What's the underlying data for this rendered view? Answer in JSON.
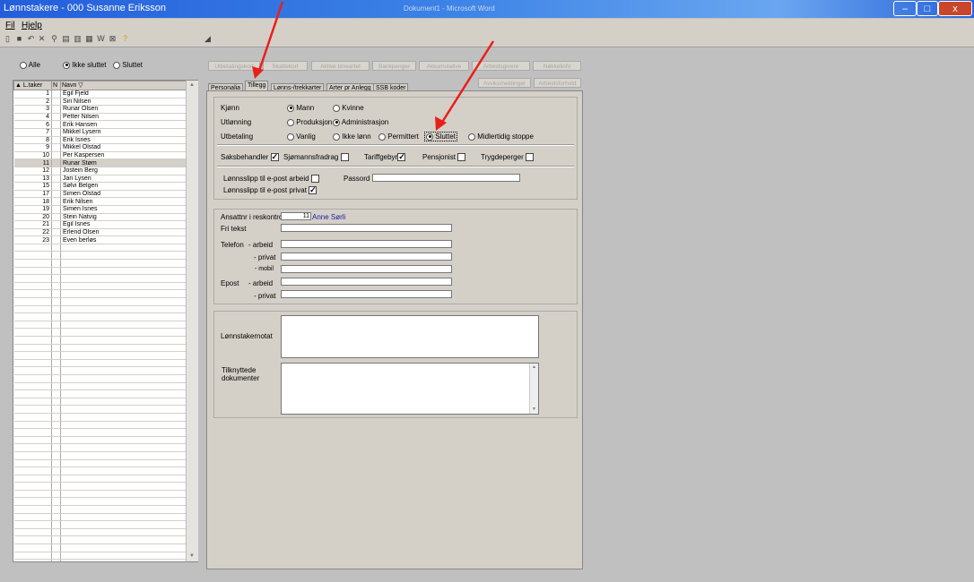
{
  "window": {
    "title": "Lønnstakere - 000 Susanne Eriksson",
    "bg_title": "Dokument1 - Microsoft Word"
  },
  "menu": {
    "file": "Fil",
    "help": "Hjelp"
  },
  "filter": {
    "all": "Alle",
    "active": "Ikke sluttet",
    "quit": "Sluttet",
    "selected": "active"
  },
  "list": {
    "headers": {
      "id": "▲ L.taker",
      "n": "N",
      "name": "Navn ▽"
    },
    "rows": [
      {
        "id": "1",
        "name": "Egil Fjeld"
      },
      {
        "id": "2",
        "name": "Siri Nilsen"
      },
      {
        "id": "3",
        "name": "Runar Olsen"
      },
      {
        "id": "4",
        "name": "Petter Nilsen"
      },
      {
        "id": "6",
        "name": "Erik Hansen"
      },
      {
        "id": "7",
        "name": "Mikkel Lysern"
      },
      {
        "id": "8",
        "name": "Erik Isnes"
      },
      {
        "id": "9",
        "name": "Mikkel Olstad"
      },
      {
        "id": "10",
        "name": "Per Kaspersen"
      },
      {
        "id": "11",
        "name": "Runar Støm"
      },
      {
        "id": "12",
        "name": "Jostein Berg"
      },
      {
        "id": "13",
        "name": "Jan Lysen"
      },
      {
        "id": "15",
        "name": "Sølvi Belgen"
      },
      {
        "id": "17",
        "name": "Simen Olstad"
      },
      {
        "id": "18",
        "name": "Erik Nilsen"
      },
      {
        "id": "19",
        "name": "Simen Isnes"
      },
      {
        "id": "20",
        "name": "Stein Natvig"
      },
      {
        "id": "21",
        "name": "Egil Isnes"
      },
      {
        "id": "22",
        "name": "Erlend Olsen"
      },
      {
        "id": "23",
        "name": "Even berløs"
      }
    ],
    "selected_id": "11"
  },
  "top_buttons": [
    "Utbetalingskort",
    "Skattekort",
    "Aktive timeartet",
    "Bankpenger",
    "Akkumulative",
    "Arbeidsgivere",
    "Nøkkelinfo",
    "Avviksmeldinger",
    "Arbeidsforhold"
  ],
  "tabs": [
    "Personalia",
    "Tillegg",
    "Lønns-/trekkarter",
    "Arter pr Anlegg",
    "SSB koder"
  ],
  "active_tab": 1,
  "form": {
    "gender": {
      "label": "Kjønn",
      "male": "Mann",
      "female": "Kvinne"
    },
    "lending": {
      "label": "Utlønning",
      "production": "Produksjon",
      "admin": "Administrasjon"
    },
    "payout": {
      "label": "Utbetaling",
      "normal": "Vanlig",
      "no_pay": "Ikke lønn",
      "laid_off": "Permittert",
      "quit": "Sluttet",
      "temp_stop": "Midlertidig stoppe"
    },
    "checks": {
      "case_handler": "Saksbehandler",
      "seaman": "Sjømannsfradrag",
      "tariff": "Tariffgebyr",
      "pension": "Pensjonist",
      "insurance": "Trygdeperger",
      "case_handler_on": true,
      "tariff_on": true
    },
    "email_slip": {
      "work": "Lønnsslipp til e-post arbeid",
      "private": "Lønnsslipp til e-post privat",
      "password": "Passord"
    },
    "contact": {
      "account_label": "Ansattnr i reskontro",
      "account_no": "11",
      "account_name": "Anne Sørli",
      "free_text": "Fri tekst",
      "phone": "Telefon",
      "phone_work": "- arbeid",
      "phone_private": "- privat",
      "phone_mobile": "- mobil",
      "email": "Epost",
      "email_work": "- arbeid",
      "email_private": "- privat"
    },
    "notes": {
      "comment": "Lønnstakernotat",
      "docs": "Tilknyttede dokumenter"
    }
  },
  "colors": {
    "arrow": "#e8201a",
    "link": "#1a1aa0"
  }
}
